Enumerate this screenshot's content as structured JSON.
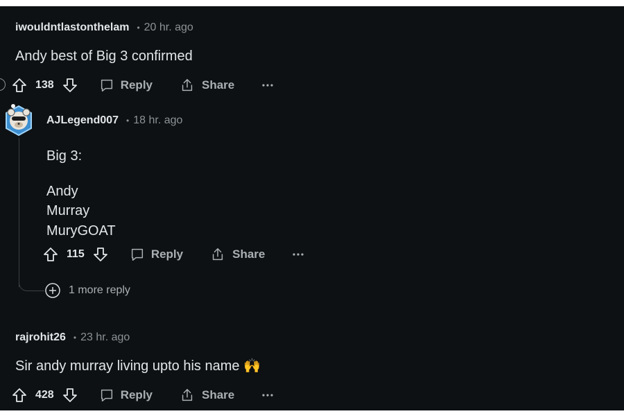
{
  "comments": [
    {
      "username": "iwouldntlastonthelam",
      "time": "20 hr. ago",
      "body": "Andy best of Big 3 confirmed",
      "votes": "138",
      "reply_label": "Reply",
      "share_label": "Share"
    },
    {
      "username": "AJLegend007",
      "time": "18 hr. ago",
      "body_lines": [
        "Big 3:",
        "Andy",
        "Murray",
        "MuryGOAT"
      ],
      "votes": "115",
      "reply_label": "Reply",
      "share_label": "Share",
      "more_replies": "1 more reply"
    },
    {
      "username": "rajrohit26",
      "time": "23 hr. ago",
      "body": "Sir andy murray living upto his name 🙌",
      "votes": "428",
      "reply_label": "Reply",
      "share_label": "Share"
    }
  ],
  "meta_separator": "•",
  "colors": {
    "background": "#0e1113",
    "text": "#e3e6e8",
    "muted": "#8b9296",
    "action": "#a9b0b4"
  }
}
